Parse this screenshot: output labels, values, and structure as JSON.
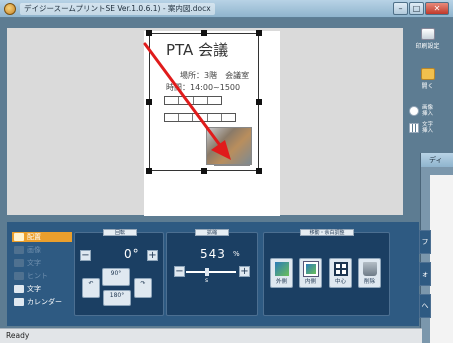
{
  "window": {
    "title": "デイジースームプリントSE Ver.1.0.6.1) - 案内図.docx",
    "controls": [
      "minimize",
      "maximize",
      "close"
    ]
  },
  "document": {
    "heading": "PTA 会議",
    "place": "場所：3階　会議室",
    "time": "時間：14:00~1500"
  },
  "toolbar": {
    "print_settings": "印刷設定",
    "open": "開く",
    "insert_image": "画像\n挿入",
    "insert_text": "文字\n挿入"
  },
  "sub_window": {
    "title": "ディ"
  },
  "side_menu": {
    "items": [
      {
        "label": "配置",
        "state": "active"
      },
      {
        "label": "画像",
        "state": "dim"
      },
      {
        "label": "文字",
        "state": "dim"
      },
      {
        "label": "ヒント",
        "state": "dim"
      },
      {
        "label": "文字",
        "state": "normal"
      },
      {
        "label": "カレンダー",
        "state": "normal"
      }
    ]
  },
  "rotation": {
    "label": "回転",
    "value": "0°",
    "rotate_90": "90°",
    "rotate_180": "180°",
    "flip_left": "",
    "flip_right": ""
  },
  "scale": {
    "label": "拡縮",
    "value": "543",
    "unit": "%",
    "slider_value": 0.4
  },
  "alignment": {
    "label": "移動・余白調整",
    "buttons": [
      {
        "label": "外側",
        "icon": "outer-align-icon"
      },
      {
        "label": "内側",
        "icon": "inner-align-icon"
      },
      {
        "label": "中心",
        "icon": "center-align-icon"
      },
      {
        "label": "削除",
        "icon": "trash-icon"
      }
    ]
  },
  "edge_tabs": [
    "フ",
    "ォ",
    "へ"
  ],
  "status": {
    "text": "Ready"
  },
  "colors": {
    "background": "#5d7c92",
    "panel": "#2e5a82",
    "accent": "#eb9f2c",
    "annotation_arrow": "#e01b1b"
  }
}
